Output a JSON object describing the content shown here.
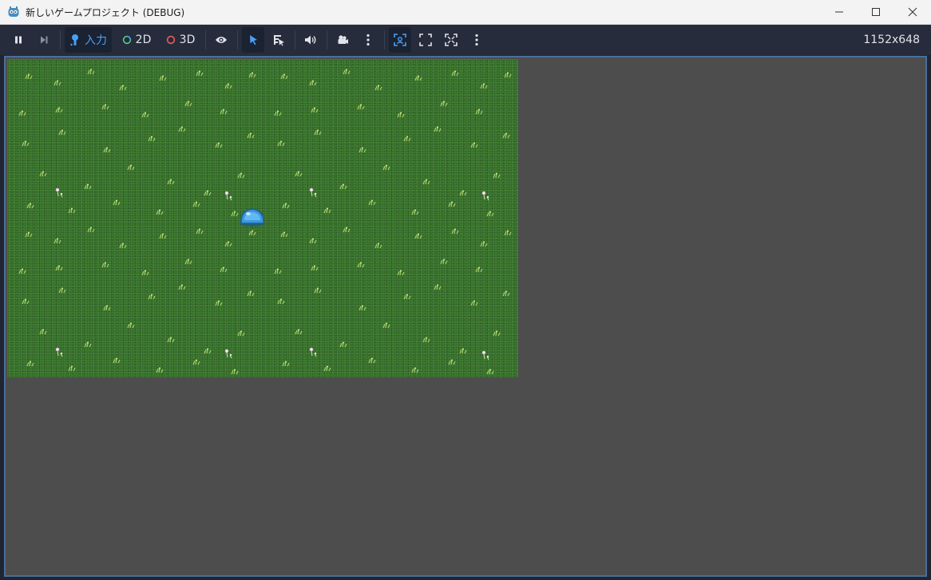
{
  "window": {
    "title": "新しいゲームプロジェクト (DEBUG)",
    "icon": "godot-icon",
    "controls": [
      "minimize-icon",
      "maximize-icon",
      "close-icon"
    ]
  },
  "toolbar": {
    "input_label": "入力",
    "mode_2d_label": "2D",
    "mode_3d_label": "3D",
    "resolution": "1152x648",
    "colors": {
      "accent": "#4a9ff5",
      "ring_3d": "#f05a5a",
      "background": "#262c3b"
    }
  },
  "game": {
    "background_color": "#3f7a32",
    "void_color": "#4d4d4d",
    "player_sprite": "slime"
  }
}
